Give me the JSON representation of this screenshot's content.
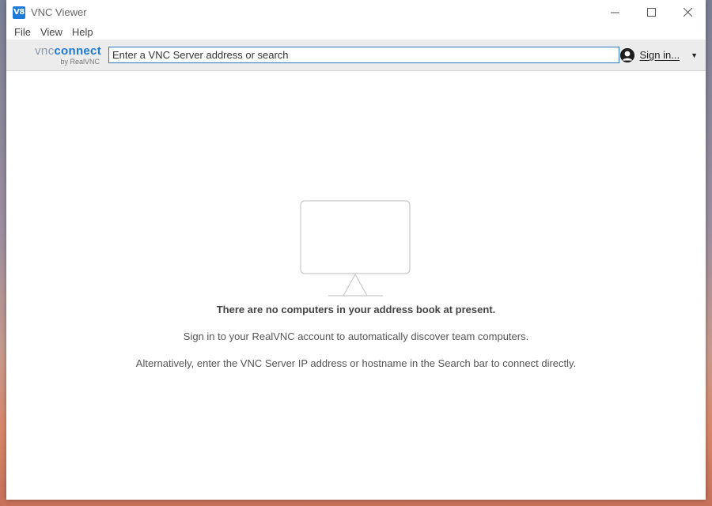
{
  "window": {
    "title": "VNC Viewer",
    "app_icon_text": "V8"
  },
  "menu": {
    "items": [
      "File",
      "View",
      "Help"
    ]
  },
  "toolbar": {
    "brand_vnc": "vnc",
    "brand_connect": "connect",
    "brand_sub": "by RealVNC",
    "search_placeholder": "Enter a VNC Server address or search",
    "sign_in_label": "Sign in..."
  },
  "empty_state": {
    "title": "There are no computers in your address book at present.",
    "line1": "Sign in to your RealVNC account to automatically discover team computers.",
    "line2": "Alternatively, enter the VNC Server IP address or hostname in the Search bar to connect directly."
  },
  "colors": {
    "accent": "#1e7ad6",
    "input_border": "#2f78c4"
  }
}
